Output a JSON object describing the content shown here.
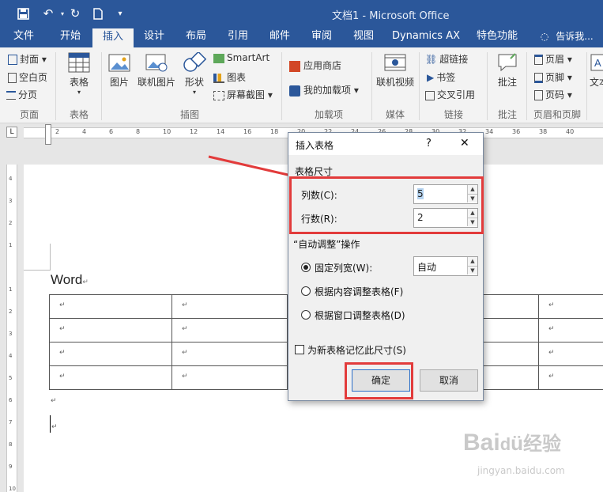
{
  "title": "文档1 - Microsoft Office",
  "tabs": [
    {
      "label": "文件"
    },
    {
      "label": "开始"
    },
    {
      "label": "插入"
    },
    {
      "label": "设计"
    },
    {
      "label": "布局"
    },
    {
      "label": "引用"
    },
    {
      "label": "邮件"
    },
    {
      "label": "审阅"
    },
    {
      "label": "视图"
    },
    {
      "label": "Dynamics AX"
    },
    {
      "label": "特色功能"
    },
    {
      "label": "告诉我..."
    }
  ],
  "ribbon": {
    "pages": {
      "cover": "封面",
      "blank": "空白页",
      "break": "分页",
      "label": "页面"
    },
    "table": {
      "btn": "表格",
      "label": "表格"
    },
    "illus": {
      "picture": "图片",
      "online": "联机图片",
      "shapes": "形状",
      "smartart": "SmartArt",
      "chart": "图表",
      "screenshot": "屏幕截图",
      "label": "插图"
    },
    "addins": {
      "store": "应用商店",
      "mine": "我的加载项",
      "label": "加载项"
    },
    "media": {
      "video": "联机视频",
      "label": "媒体"
    },
    "links": {
      "hyperlink": "超链接",
      "bookmark": "书签",
      "crossref": "交叉引用",
      "label": "链接"
    },
    "comments": {
      "comment": "批注",
      "label": "批注"
    },
    "hf": {
      "header": "页眉",
      "footer": "页脚",
      "pagenum": "页码",
      "label": "页眉和页脚"
    },
    "text": {
      "textbox": "文本"
    }
  },
  "document": {
    "text": "Word"
  },
  "dialog": {
    "title": "插入表格",
    "help": "?",
    "close": "✕",
    "size_section": "表格尺寸",
    "cols_label": "列数(C):",
    "cols_value": "5",
    "rows_label": "行数(R):",
    "rows_value": "2",
    "autofit_section": "“自动调整”操作",
    "fixed_label": "固定列宽(W):",
    "fixed_value": "自动",
    "content_label": "根据内容调整表格(F)",
    "window_label": "根据窗口调整表格(D)",
    "remember_label": "为新表格记忆此尺寸(S)",
    "ok": "确定",
    "cancel": "取消"
  },
  "watermark": {
    "brand": "Bai",
    "brand2": "经验",
    "url": "jingyan.baidu.com"
  },
  "accent": "#2b579a",
  "highlight": "#e23b3b"
}
